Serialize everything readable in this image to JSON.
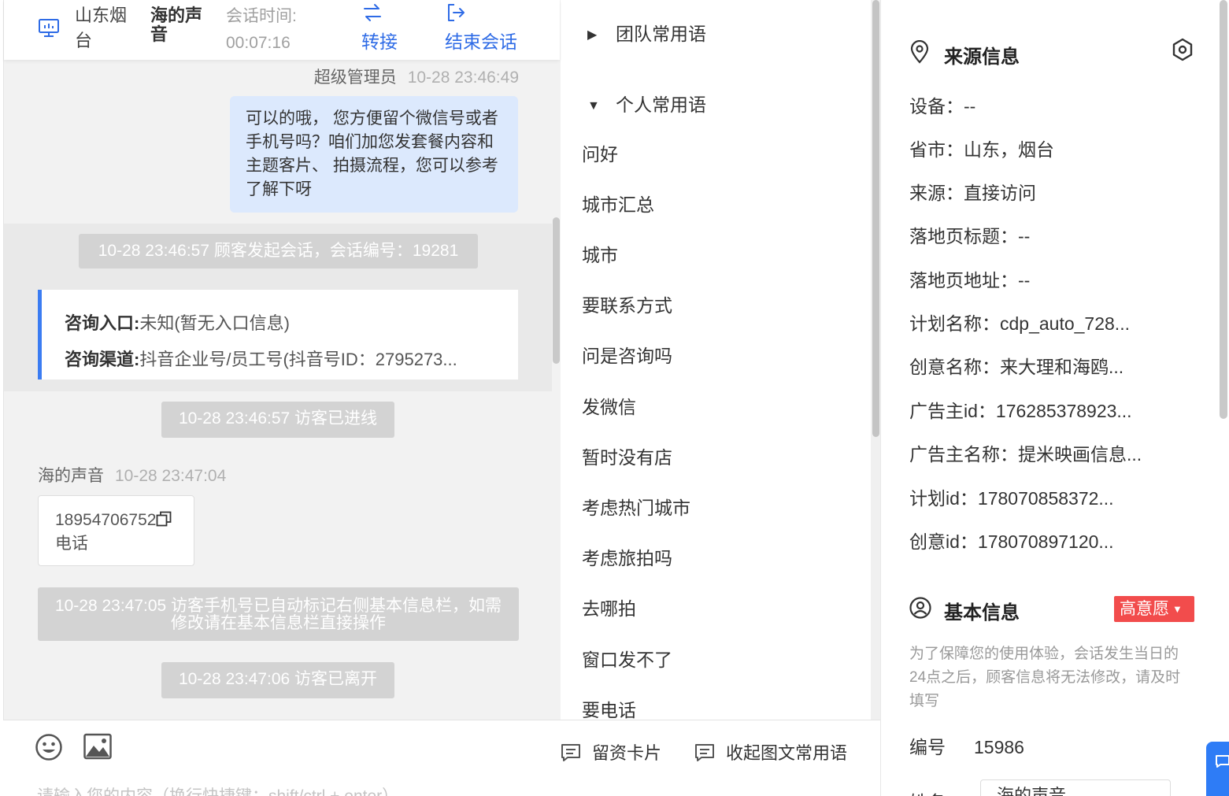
{
  "header": {
    "location": "山东烟台",
    "visitor_name": "海的声音",
    "session_time_label": "会话时间:",
    "session_time_value": "00:07:16",
    "transfer_label": "转接",
    "end_label": "结束会话"
  },
  "chat": {
    "agent_name": "超级管理员",
    "agent_time": "10-28 23:46:49",
    "agent_message": "可以的哦， 您方便留个微信号或者手机号吗？咱们加您发套餐内容和主题客片、 拍摄流程，您可以参考了解下呀",
    "sys_started": "10-28 23:46:57 顾客发起会话，会话编号：19281",
    "entry_label": "咨询入口:",
    "entry_value": "未知(暂无入口信息)",
    "channel_label": "咨询渠道:",
    "channel_value": "抖音企业号/员工号(抖音号ID：2795273...",
    "sys_joined": "10-28 23:46:57 访客已进线",
    "customer_name": "海的声音",
    "customer_time": "10-28 23:47:04",
    "phone_number": "18954706752",
    "phone_label": "电话",
    "sys_phone_marked": "10-28 23:47:05 访客手机号已自动标记右侧基本信息栏，如需修改请在基本信息栏直接操作",
    "sys_left": "10-28 23:47:06 访客已离开"
  },
  "input": {
    "card_label": "留资卡片",
    "collapse_label": "收起图文常用语",
    "placeholder": "请输入您的内容（换行快捷键：shift/ctrl + enter）"
  },
  "phrases": {
    "team_group": "团队常用语",
    "personal_group": "个人常用语",
    "items": [
      "问好",
      "城市汇总",
      "城市",
      "要联系方式",
      "问是咨询吗",
      "发微信",
      "暂时没有店",
      "考虑热门城市",
      "考虑旅拍吗",
      "去哪拍",
      "窗口发不了",
      "要电话"
    ]
  },
  "source_info": {
    "title": "来源信息",
    "rows": [
      "设备：--",
      "省市：山东，烟台",
      "来源：直接访问",
      "落地页标题：--",
      "落地页地址：--",
      "计划名称：cdp_auto_728...",
      "创意名称：来大理和海鸥...",
      "广告主id：176285378923...",
      "广告主名称：提米映画信息...",
      "计划id：178070858372...",
      "创意id：178070897120..."
    ]
  },
  "basic_info": {
    "title": "基本信息",
    "intent_label": "高意愿",
    "notice": "为了保障您的使用体验，会话发生当日的24点之后，顾客信息将无法修改，请及时填写",
    "id_label": "编号",
    "id_value": "15986",
    "next_label": "姓名",
    "next_value": "海的声音"
  },
  "colors": {
    "accent": "#2e6be6",
    "agent_bubble": "#dce9fd",
    "intent_badge": "#f24c4c",
    "entry_border": "#3b7cf2"
  }
}
